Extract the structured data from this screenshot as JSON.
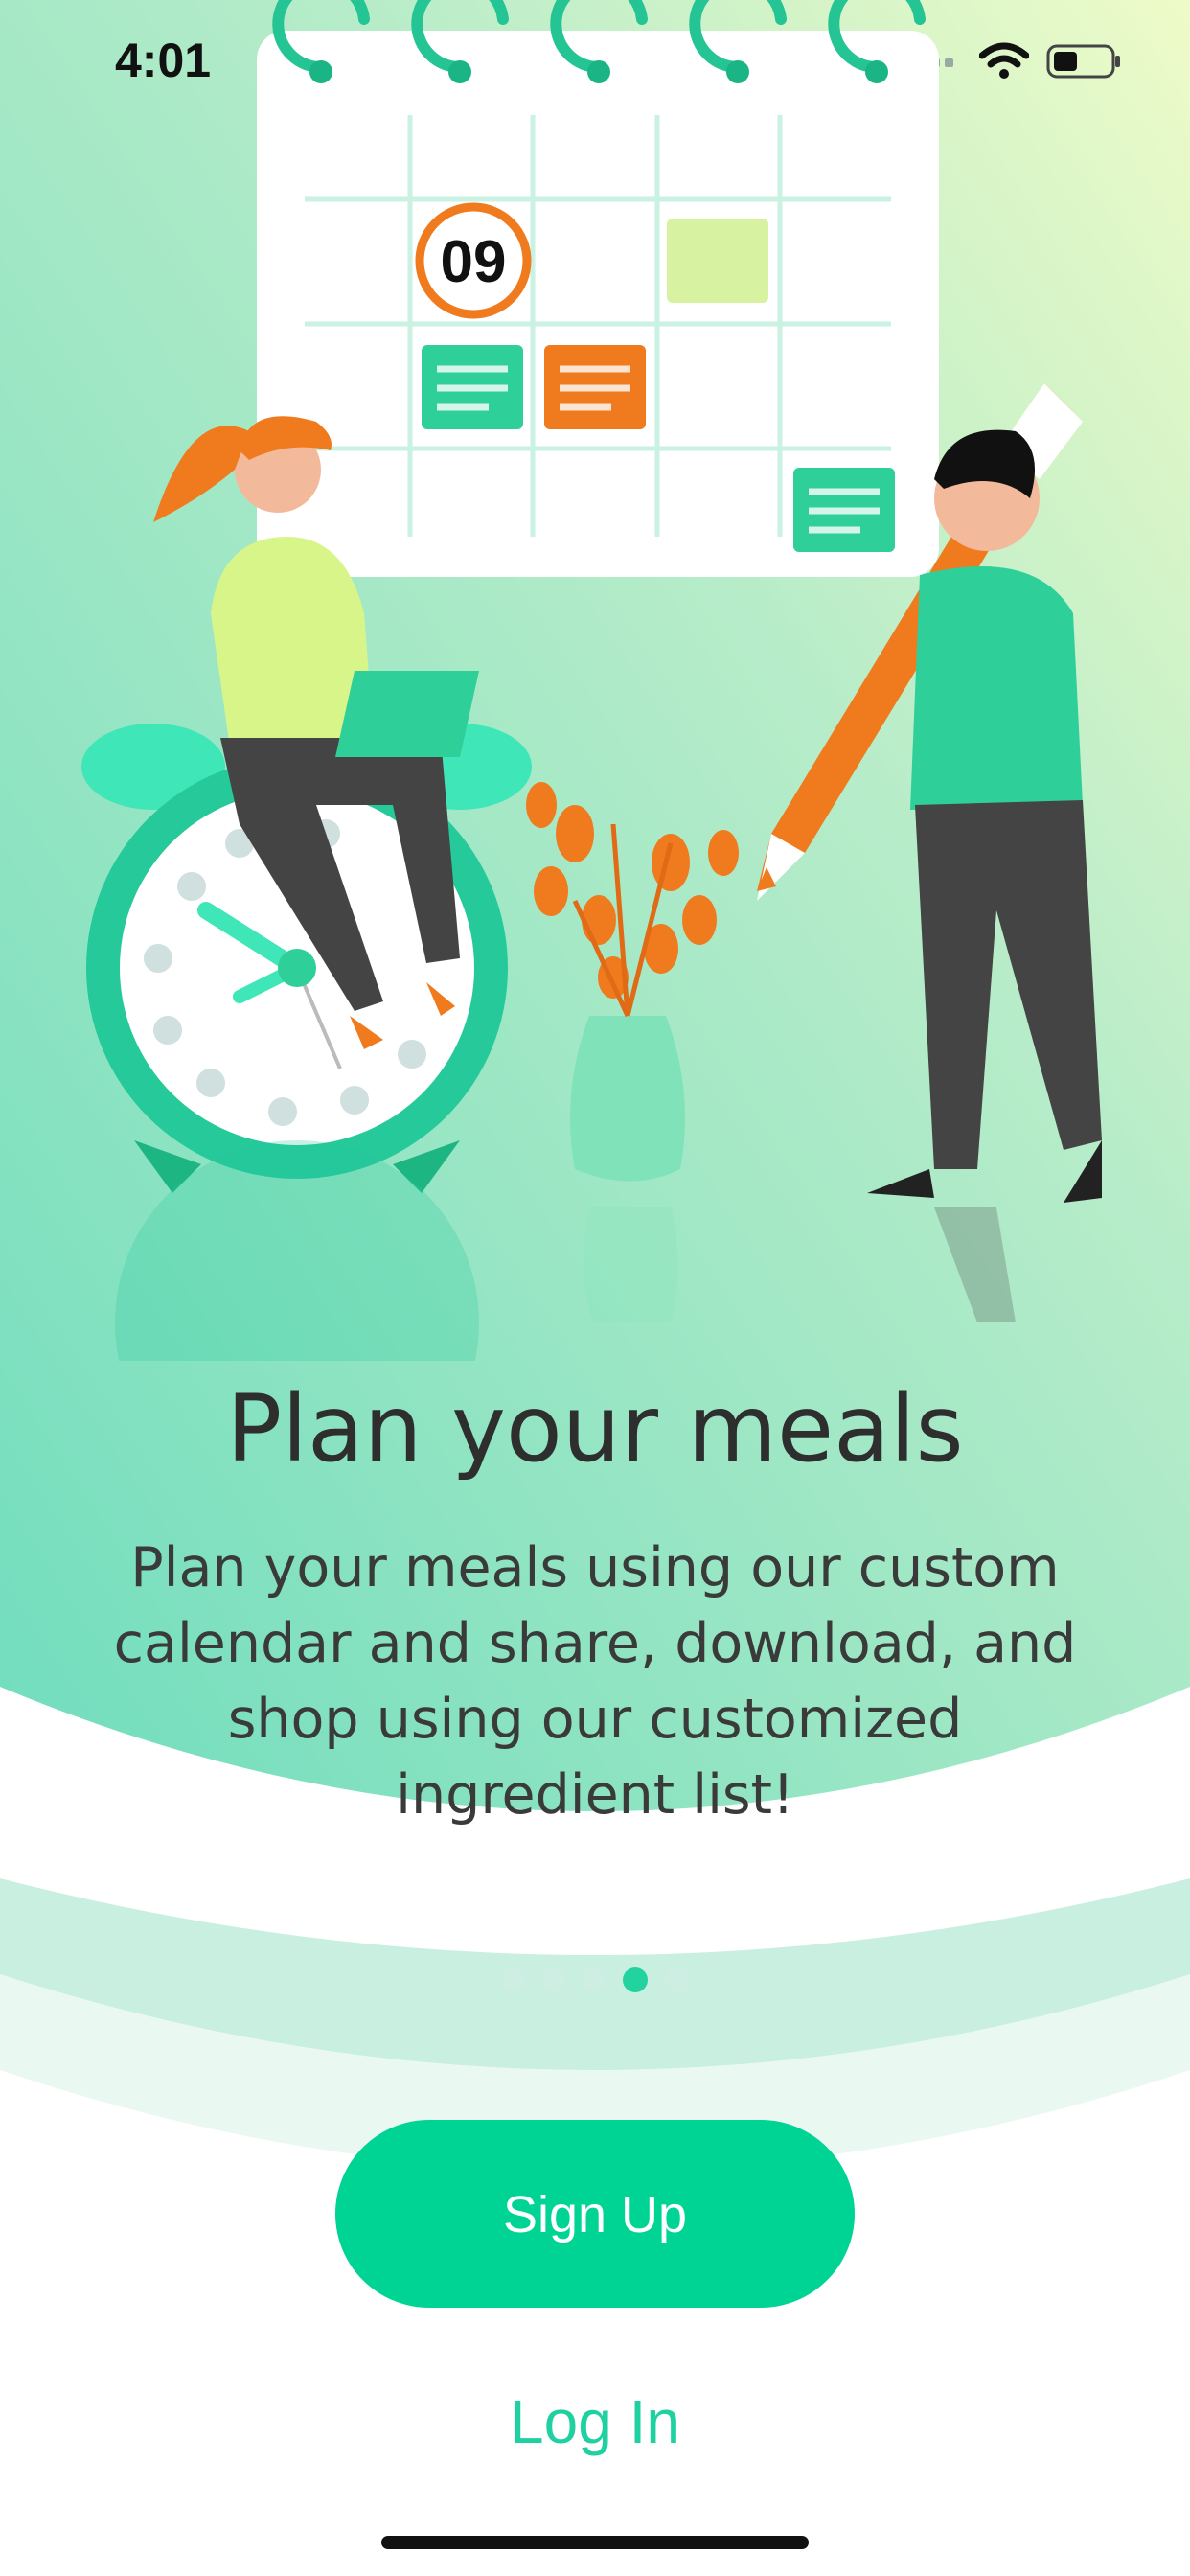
{
  "status_bar": {
    "time": "4:01",
    "icons": [
      "signal-icon",
      "wifi-icon",
      "battery-icon"
    ]
  },
  "illustration": {
    "calendar_date": "09",
    "description_icon": "meal-planning-illustration"
  },
  "onboarding": {
    "title": "Plan your meals",
    "description": "Plan your meals using our custom calendar and share, download, and shop using our customized ingredient list!",
    "page_indicator": {
      "total": 5,
      "current": 4
    }
  },
  "actions": {
    "signup_label": "Sign Up",
    "login_label": "Log In"
  },
  "colors": {
    "accent": "#00d494",
    "login_text": "#1fd1a0",
    "bg_gradient_top": "#e6f9c8",
    "bg_gradient_mid": "#7fe2c0",
    "orange": "#f07a1e"
  }
}
